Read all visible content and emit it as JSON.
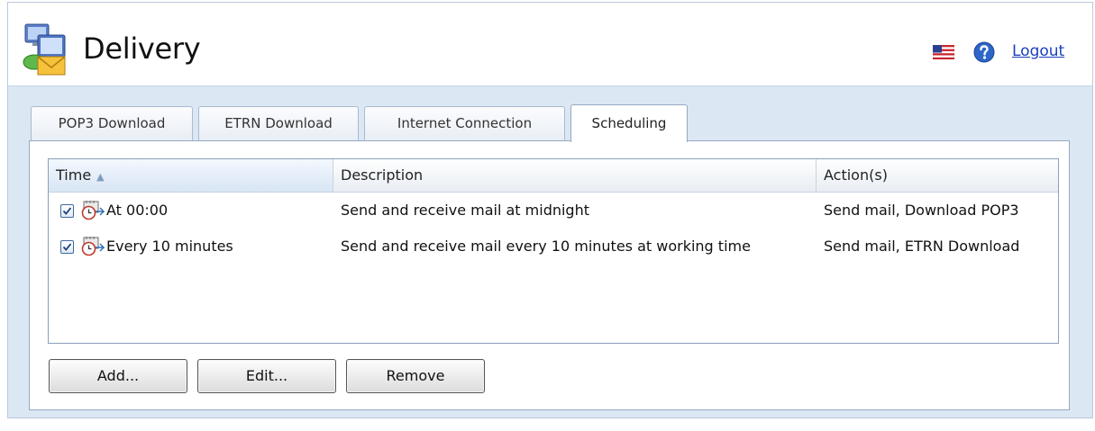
{
  "header": {
    "title": "Delivery",
    "app_icon": "delivery-icon",
    "flag_icon": "us-flag-icon",
    "help_icon": "help-icon",
    "logout_label": "Logout"
  },
  "tabs": [
    {
      "label": "POP3 Download",
      "active": false
    },
    {
      "label": "ETRN Download",
      "active": false
    },
    {
      "label": "Internet Connection",
      "active": false
    },
    {
      "label": "Scheduling",
      "active": true
    }
  ],
  "table": {
    "columns": [
      {
        "label": "Time",
        "sorted": "ascending"
      },
      {
        "label": "Description"
      },
      {
        "label": "Action(s)"
      }
    ],
    "rows": [
      {
        "checked": true,
        "icon": "schedule-clock-icon",
        "time": "At 00:00",
        "description": "Send and receive mail at midnight",
        "actions": "Send mail, Download POP3"
      },
      {
        "checked": true,
        "icon": "schedule-clock-icon",
        "time": "Every 10 minutes",
        "description": "Send and receive mail every 10 minutes at working time",
        "actions": "Send mail, ETRN Download"
      }
    ]
  },
  "buttons": {
    "add": "Add...",
    "edit": "Edit...",
    "remove": "Remove"
  },
  "colors": {
    "link": "#1a3fbf",
    "background_panel": "#dce7f4",
    "border": "#96a9c2"
  }
}
